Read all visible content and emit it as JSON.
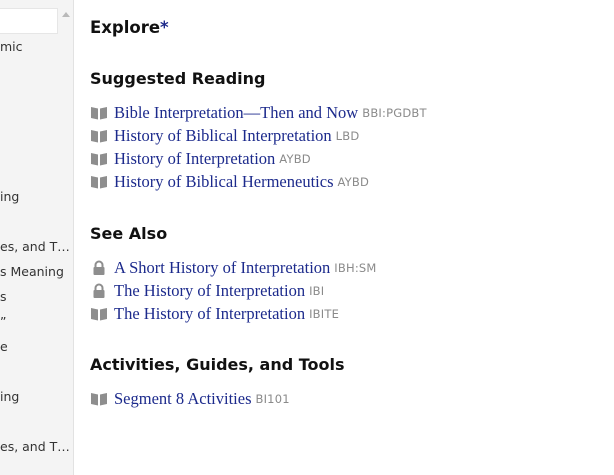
{
  "sidebar": {
    "items": [
      {
        "label": "mic"
      },
      {
        "label": "ing"
      },
      {
        "label": "es, and T…"
      },
      {
        "label": "s Meaning"
      },
      {
        "label": "s"
      },
      {
        "label": "”"
      },
      {
        "label": "e"
      },
      {
        "label": "ing"
      },
      {
        "label": "es, and T…"
      }
    ]
  },
  "explore": {
    "title": "Explore",
    "star": "*"
  },
  "suggested": {
    "heading": "Suggested Reading",
    "items": [
      {
        "title": "Bible Interpretation—Then and Now",
        "abbr": "BBI:PGDBT",
        "icon": "book-icon"
      },
      {
        "title": "History of Biblical Interpretation",
        "abbr": "LBD",
        "icon": "book-icon"
      },
      {
        "title": "History of Interpretation",
        "abbr": "AYBD",
        "icon": "book-icon"
      },
      {
        "title": "History of Biblical Hermeneutics",
        "abbr": "AYBD",
        "icon": "book-icon"
      }
    ]
  },
  "see_also": {
    "heading": "See Also",
    "items": [
      {
        "title": "A Short History of Interpretation",
        "abbr": "IBH:SM",
        "icon": "lock-icon"
      },
      {
        "title": "The History of Interpretation",
        "abbr": "IBI",
        "icon": "lock-icon"
      },
      {
        "title": "The History of Interpretation",
        "abbr": "IBITE",
        "icon": "book-icon"
      }
    ]
  },
  "activities": {
    "heading": "Activities, Guides, and Tools",
    "items": [
      {
        "title": "Segment 8 Activities",
        "abbr": "BI101",
        "icon": "book-icon"
      }
    ]
  },
  "colors": {
    "link": "#1c2a8c",
    "abbr": "#8a8a8a",
    "icon": "#8e8e8e",
    "sidebar_bg": "#f4f4f4"
  }
}
